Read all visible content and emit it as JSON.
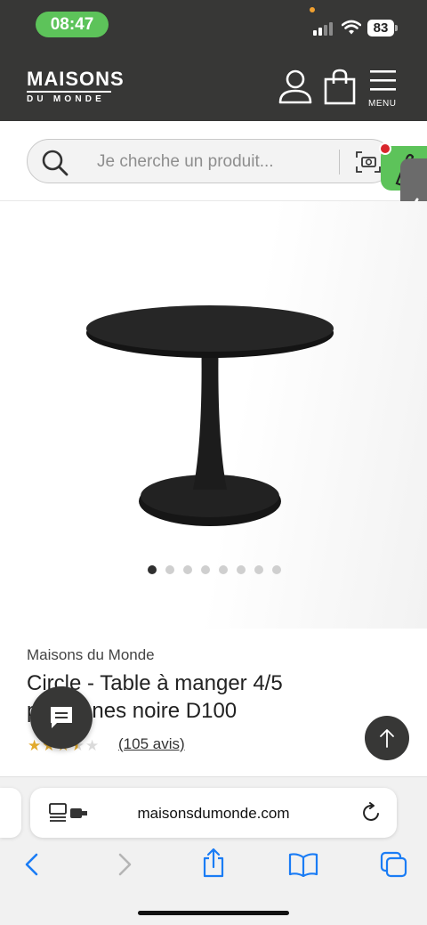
{
  "status_bar": {
    "time": "08:47",
    "battery": "83"
  },
  "header": {
    "logo_main": "MAISONS",
    "logo_sub": "DU MONDE",
    "menu_label": "MENU",
    "icons": [
      "user-icon",
      "shopping-bag-icon",
      "hamburger-menu-icon"
    ]
  },
  "search": {
    "placeholder": "Je cherche un produit...",
    "icons": [
      "search-icon",
      "camera-search-icon"
    ]
  },
  "gallery": {
    "image_count": 8,
    "active_index": 0
  },
  "product": {
    "brand": "Maisons du Monde",
    "title": "Circle - Table à manger 4/5 personnes noire D100",
    "rating": 3.5,
    "rating_max": 5,
    "reviews_label": "(105 avis)"
  },
  "browser": {
    "url": "maisonsdumonde.com",
    "icons": [
      "reader-mode-icon",
      "reload-icon",
      "back-icon",
      "forward-icon",
      "share-icon",
      "bookmarks-icon",
      "tabs-icon"
    ]
  },
  "colors": {
    "header_bg": "#373736",
    "accent_green": "#5dc35a",
    "star": "#e2aa2c",
    "ios_blue": "#1a7cf5"
  }
}
